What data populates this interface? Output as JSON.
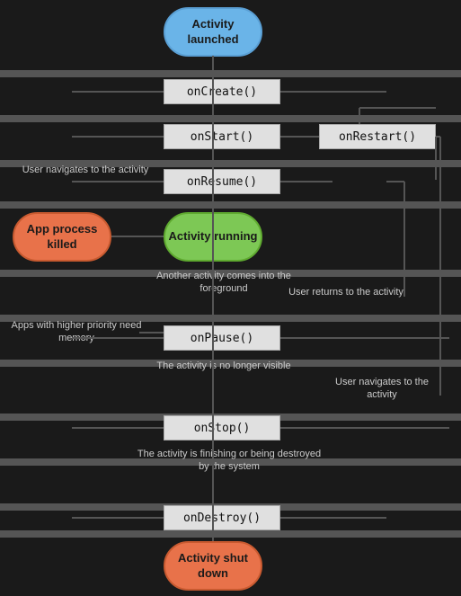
{
  "shapes": {
    "activity_launched": "Activity\nlaunched",
    "activity_running": "Activity\nrunning",
    "app_process_killed": "App process\nkilled",
    "activity_shut_down": "Activity\nshut down"
  },
  "methods": {
    "onCreate": "onCreate()",
    "onStart": "onStart()",
    "onRestart": "onRestart()",
    "onResume": "onResume()",
    "onPause": "onPause()",
    "onStop": "onStop()",
    "onDestroy": "onDestroy()"
  },
  "labels": {
    "user_navigates_to": "User navigates\nto the activity",
    "user_returns_to": "User returns\nto the activity",
    "another_activity": "Another activity comes\ninto the foreground",
    "apps_higher_priority": "Apps with higher priority\nneed memory",
    "activity_no_longer_visible": "The activity is\nno longer visible",
    "user_navigates_to2": "User navigates\nto the activity",
    "activity_finishing": "The activity is finishing or\nbeing destroyed by the system"
  },
  "colors": {
    "background": "#1a1a1a",
    "oval_blue": "#6ab4e8",
    "oval_green": "#7dc855",
    "oval_orange": "#e8724a",
    "method_bg": "#e0e0e0",
    "line": "#555",
    "text": "#cccccc"
  }
}
